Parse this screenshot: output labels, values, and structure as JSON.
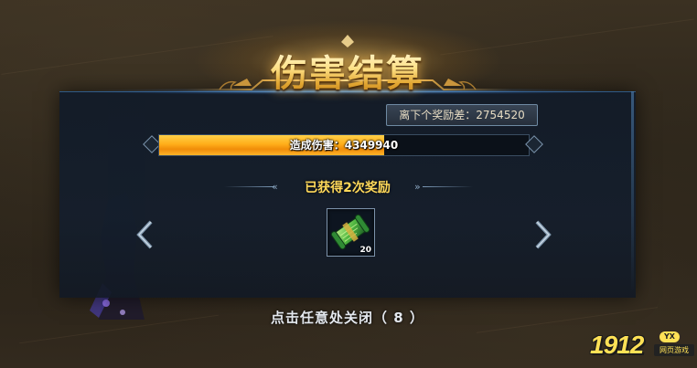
{
  "title": "伤害结算",
  "next_reward": {
    "label": "离下个奖励差",
    "value": "2754520"
  },
  "damage": {
    "label": "造成伤害",
    "value": "4349940",
    "progress_fraction": 0.61
  },
  "rewards": {
    "heading": "已获得2次奖励",
    "items": [
      {
        "icon": "green-scroll-icon",
        "count": "20"
      }
    ]
  },
  "close_hint": "点击任意处关闭（ 8 ）",
  "watermark": {
    "number": "1912",
    "badge": "YX",
    "subtitle": "网页游戏"
  },
  "colors": {
    "accent_gold": "#ffd95a",
    "progress_orange": "#ffae1a",
    "panel_bg": "#141e2c",
    "frame_blue": "#2f5a86"
  }
}
